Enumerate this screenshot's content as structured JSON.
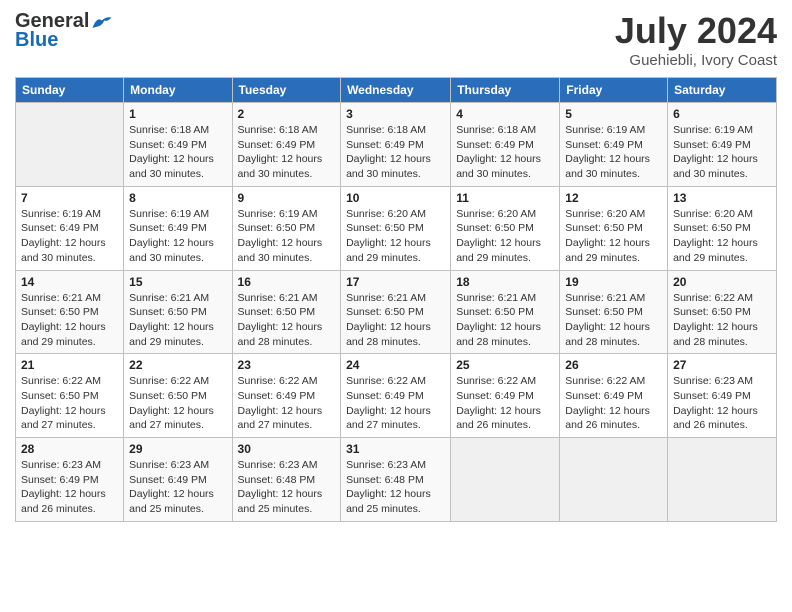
{
  "header": {
    "logo_general": "General",
    "logo_blue": "Blue",
    "month_year": "July 2024",
    "location": "Guehiebli, Ivory Coast"
  },
  "days_of_week": [
    "Sunday",
    "Monday",
    "Tuesday",
    "Wednesday",
    "Thursday",
    "Friday",
    "Saturday"
  ],
  "weeks": [
    [
      {
        "day": "",
        "info": ""
      },
      {
        "day": "1",
        "info": "Sunrise: 6:18 AM\nSunset: 6:49 PM\nDaylight: 12 hours\nand 30 minutes."
      },
      {
        "day": "2",
        "info": "Sunrise: 6:18 AM\nSunset: 6:49 PM\nDaylight: 12 hours\nand 30 minutes."
      },
      {
        "day": "3",
        "info": "Sunrise: 6:18 AM\nSunset: 6:49 PM\nDaylight: 12 hours\nand 30 minutes."
      },
      {
        "day": "4",
        "info": "Sunrise: 6:18 AM\nSunset: 6:49 PM\nDaylight: 12 hours\nand 30 minutes."
      },
      {
        "day": "5",
        "info": "Sunrise: 6:19 AM\nSunset: 6:49 PM\nDaylight: 12 hours\nand 30 minutes."
      },
      {
        "day": "6",
        "info": "Sunrise: 6:19 AM\nSunset: 6:49 PM\nDaylight: 12 hours\nand 30 minutes."
      }
    ],
    [
      {
        "day": "7",
        "info": "Sunrise: 6:19 AM\nSunset: 6:49 PM\nDaylight: 12 hours\nand 30 minutes."
      },
      {
        "day": "8",
        "info": "Sunrise: 6:19 AM\nSunset: 6:49 PM\nDaylight: 12 hours\nand 30 minutes."
      },
      {
        "day": "9",
        "info": "Sunrise: 6:19 AM\nSunset: 6:50 PM\nDaylight: 12 hours\nand 30 minutes."
      },
      {
        "day": "10",
        "info": "Sunrise: 6:20 AM\nSunset: 6:50 PM\nDaylight: 12 hours\nand 29 minutes."
      },
      {
        "day": "11",
        "info": "Sunrise: 6:20 AM\nSunset: 6:50 PM\nDaylight: 12 hours\nand 29 minutes."
      },
      {
        "day": "12",
        "info": "Sunrise: 6:20 AM\nSunset: 6:50 PM\nDaylight: 12 hours\nand 29 minutes."
      },
      {
        "day": "13",
        "info": "Sunrise: 6:20 AM\nSunset: 6:50 PM\nDaylight: 12 hours\nand 29 minutes."
      }
    ],
    [
      {
        "day": "14",
        "info": "Sunrise: 6:21 AM\nSunset: 6:50 PM\nDaylight: 12 hours\nand 29 minutes."
      },
      {
        "day": "15",
        "info": "Sunrise: 6:21 AM\nSunset: 6:50 PM\nDaylight: 12 hours\nand 29 minutes."
      },
      {
        "day": "16",
        "info": "Sunrise: 6:21 AM\nSunset: 6:50 PM\nDaylight: 12 hours\nand 28 minutes."
      },
      {
        "day": "17",
        "info": "Sunrise: 6:21 AM\nSunset: 6:50 PM\nDaylight: 12 hours\nand 28 minutes."
      },
      {
        "day": "18",
        "info": "Sunrise: 6:21 AM\nSunset: 6:50 PM\nDaylight: 12 hours\nand 28 minutes."
      },
      {
        "day": "19",
        "info": "Sunrise: 6:21 AM\nSunset: 6:50 PM\nDaylight: 12 hours\nand 28 minutes."
      },
      {
        "day": "20",
        "info": "Sunrise: 6:22 AM\nSunset: 6:50 PM\nDaylight: 12 hours\nand 28 minutes."
      }
    ],
    [
      {
        "day": "21",
        "info": "Sunrise: 6:22 AM\nSunset: 6:50 PM\nDaylight: 12 hours\nand 27 minutes."
      },
      {
        "day": "22",
        "info": "Sunrise: 6:22 AM\nSunset: 6:50 PM\nDaylight: 12 hours\nand 27 minutes."
      },
      {
        "day": "23",
        "info": "Sunrise: 6:22 AM\nSunset: 6:49 PM\nDaylight: 12 hours\nand 27 minutes."
      },
      {
        "day": "24",
        "info": "Sunrise: 6:22 AM\nSunset: 6:49 PM\nDaylight: 12 hours\nand 27 minutes."
      },
      {
        "day": "25",
        "info": "Sunrise: 6:22 AM\nSunset: 6:49 PM\nDaylight: 12 hours\nand 26 minutes."
      },
      {
        "day": "26",
        "info": "Sunrise: 6:22 AM\nSunset: 6:49 PM\nDaylight: 12 hours\nand 26 minutes."
      },
      {
        "day": "27",
        "info": "Sunrise: 6:23 AM\nSunset: 6:49 PM\nDaylight: 12 hours\nand 26 minutes."
      }
    ],
    [
      {
        "day": "28",
        "info": "Sunrise: 6:23 AM\nSunset: 6:49 PM\nDaylight: 12 hours\nand 26 minutes."
      },
      {
        "day": "29",
        "info": "Sunrise: 6:23 AM\nSunset: 6:49 PM\nDaylight: 12 hours\nand 25 minutes."
      },
      {
        "day": "30",
        "info": "Sunrise: 6:23 AM\nSunset: 6:48 PM\nDaylight: 12 hours\nand 25 minutes."
      },
      {
        "day": "31",
        "info": "Sunrise: 6:23 AM\nSunset: 6:48 PM\nDaylight: 12 hours\nand 25 minutes."
      },
      {
        "day": "",
        "info": ""
      },
      {
        "day": "",
        "info": ""
      },
      {
        "day": "",
        "info": ""
      }
    ]
  ]
}
